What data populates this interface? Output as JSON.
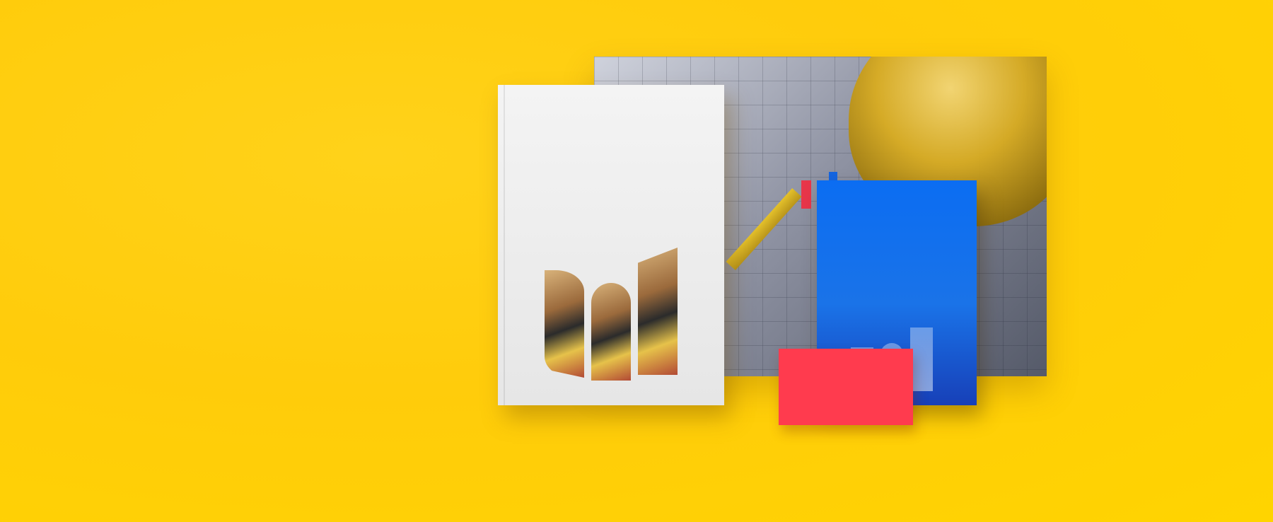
{
  "scene": {
    "description_type": "brand stationery mockup",
    "colors": {
      "background": "#ffcc0b",
      "brochure": "#f0f0f0",
      "booklet": "#1a73e8",
      "card": "#ff3b4e",
      "hardhat": "#d9ac20"
    }
  }
}
